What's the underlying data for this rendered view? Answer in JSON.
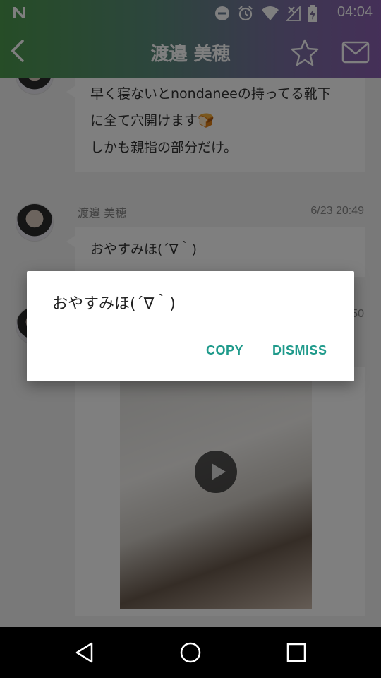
{
  "status_bar": {
    "time": "04:04",
    "icons": [
      "n-notification-icon",
      "do-not-disturb-icon",
      "alarm-icon",
      "wifi-icon",
      "no-signal-icon",
      "battery-charging-icon"
    ]
  },
  "header": {
    "title": "渡邉 美穂",
    "back_icon": "chevron-left-icon",
    "star_icon": "star-outline-icon",
    "mail_icon": "mail-icon"
  },
  "messages": [
    {
      "text_lines": [
        "早く寝ないとnondaneeの持ってる靴下",
        "に全て穴開けます🍞",
        "しかも親指の部分だけ。"
      ]
    },
    {
      "sender": "渡邉 美穂",
      "timestamp": "6/23 20:49",
      "text": "おやすみほ(´∇｀)"
    },
    {
      "timestamp_partial": "50",
      "media": "video"
    }
  ],
  "dialog": {
    "message": "おやすみほ(´∇｀)",
    "copy_label": "COPY",
    "dismiss_label": "DISMISS"
  },
  "colors": {
    "accent": "#1f9a8b",
    "header_start": "#4c9a4e",
    "header_end": "#8a5fb0"
  },
  "nav_bar": [
    "back-triangle-icon",
    "home-circle-icon",
    "recents-square-icon"
  ]
}
